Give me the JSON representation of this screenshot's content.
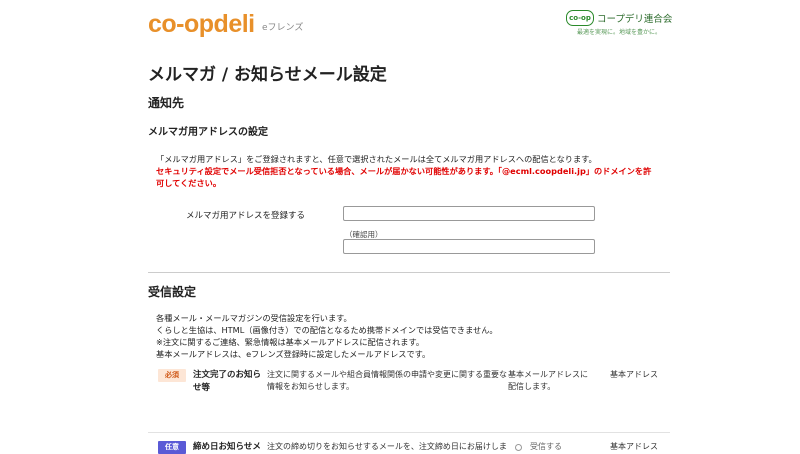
{
  "header": {
    "logo_coop": "co-op",
    "logo_deli": "deli",
    "logo_sub": "eフレンズ",
    "coop_badge": "co-op",
    "coop_name": "コープデリ連合会",
    "coop_tagline": "最適を実現に。地域を豊かに。"
  },
  "page_title": "メルマガ / お知らせメール設定",
  "notify": {
    "heading": "通知先",
    "subheading": "メルマガ用アドレスの設定",
    "desc": "「メルマガ用アドレス」をご登録されますと、任意で選択されたメールは全てメルマガ用アドレスへの配信となります。",
    "warning_line1": "セキュリティ設定でメール受信拒否となっている場合、メールが届かない可能性があります。「@ecml.coopdeli.jp」のドメインを許",
    "warning_line2": "可してください。",
    "field_label": "メルマガ用アドレスを登録する",
    "email_value": "",
    "confirm_label": "（確認用）",
    "confirm_value": ""
  },
  "receive": {
    "heading": "受信設定",
    "lines": [
      "各種メール・メールマガジンの受信設定を行います。",
      "くらしと生協は、HTML（画像付き）での配信となるため携帯ドメインでは受信できません。",
      "※注文に関するご連絡、緊急情報は基本メールアドレスに配信されます。",
      "基本メールアドレスは、eフレンズ登録時に設定したメールアドレスです。"
    ],
    "rows": [
      {
        "badge": "必須",
        "title_line1": "注文完了のお知ら",
        "title_line2": "せ等",
        "desc_line1": "注文に関するメールや組合員情報関係の申請や変更に関する重要な",
        "desc_line2": "情報をお知らせします。",
        "dest_line1": "基本メールアドレスに",
        "dest_line2": "配信します。",
        "addr": "基本アドレス"
      },
      {
        "badge": "任意",
        "title_line1": "締め日お知らせメ",
        "desc_line1": "注文の締め切りをお知らせするメールを、注文締め日にお届けしま",
        "option": "受信する",
        "addr": "基本アドレス"
      }
    ]
  }
}
